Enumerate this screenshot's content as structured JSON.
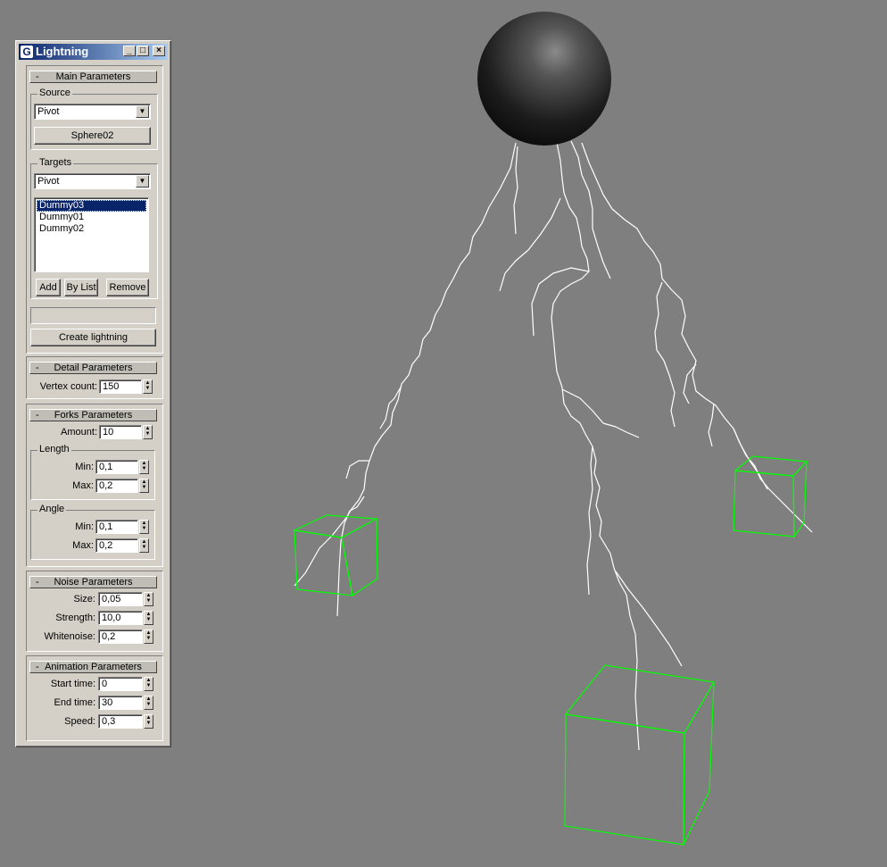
{
  "window": {
    "title": "Lightning"
  },
  "main": {
    "title": "Main Parameters",
    "collapse": "-",
    "source": {
      "label": "Source",
      "mode": "Pivot",
      "object": "Sphere02"
    },
    "targets": {
      "label": "Targets",
      "mode": "Pivot",
      "items": [
        "Dummy03",
        "Dummy01",
        "Dummy02"
      ],
      "add": "Add",
      "by_list": "By List",
      "remove": "Remove"
    },
    "status": "",
    "create": "Create lightning"
  },
  "detail": {
    "title": "Detail Parameters",
    "collapse": "-",
    "vertex_label": "Vertex count:",
    "vertex": "150"
  },
  "forks": {
    "title": "Forks Parameters",
    "collapse": "-",
    "amount_label": "Amount:",
    "amount": "10",
    "length": {
      "label": "Length",
      "min_label": "Min:",
      "min": "0,1",
      "max_label": "Max:",
      "max": "0,2"
    },
    "angle": {
      "label": "Angle",
      "min_label": "Min:",
      "min": "0,1",
      "max_label": "Max:",
      "max": "0,2"
    }
  },
  "noise": {
    "title": "Noise Parameters",
    "collapse": "-",
    "size_label": "Size:",
    "size": "0,05",
    "strength_label": "Strength:",
    "strength": "10,0",
    "whitenoise_label": "Whitenoise:",
    "whitenoise": "0,2"
  },
  "animation": {
    "title": "Animation Parameters",
    "collapse": "-",
    "start_label": "Start time:",
    "start": "0",
    "end_label": "End time:",
    "end": "30",
    "speed_label": "Speed:",
    "speed": "0,3"
  },
  "colors": {
    "viewport_bg": "#7f7f7f",
    "wireframe": "#00ff00",
    "bolt": "#ffffff",
    "panel": "#d4d0c8",
    "title_active": "#0a246a"
  },
  "icons": [
    "app-icon",
    "minimize-icon",
    "maximize-icon",
    "close-icon",
    "dropdown-arrow-icon",
    "spinner-arrows-icon"
  ]
}
